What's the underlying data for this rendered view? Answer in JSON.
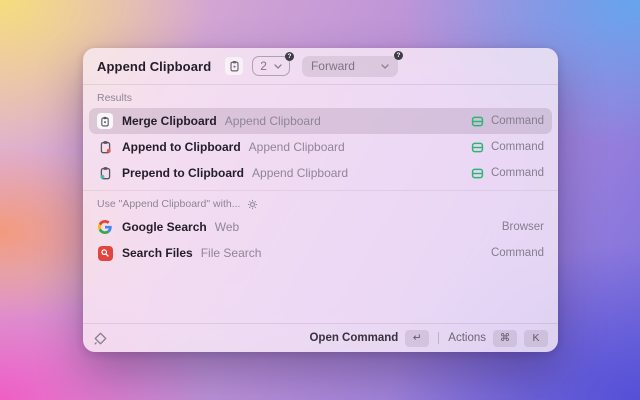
{
  "header": {
    "title": "Append Clipboard",
    "count_select": {
      "value": "2",
      "badge": "?"
    },
    "direction_select": {
      "value": "Forward",
      "badge": "?"
    }
  },
  "results": {
    "label": "Results",
    "items": [
      {
        "title": "Merge Clipboard",
        "subtitle": "Append Clipboard",
        "accessory": "Command",
        "selected": true,
        "icon": "clipboard-box-icon"
      },
      {
        "title": "Append to Clipboard",
        "subtitle": "Append Clipboard",
        "accessory": "Command",
        "selected": false,
        "icon": "clipboard-append-icon"
      },
      {
        "title": "Prepend to Clipboard",
        "subtitle": "Append Clipboard",
        "accessory": "Command",
        "selected": false,
        "icon": "clipboard-prepend-icon"
      }
    ]
  },
  "use_with": {
    "label": "Use \"Append Clipboard\" with...",
    "items": [
      {
        "title": "Google Search",
        "subtitle": "Web",
        "accessory": "Browser",
        "icon": "google-logo-icon"
      },
      {
        "title": "Search Files",
        "subtitle": "File Search",
        "accessory": "Command",
        "icon": "file-search-icon"
      }
    ]
  },
  "footer": {
    "primary_label": "Open Command",
    "primary_key": "↵",
    "actions_label": "Actions",
    "cmd_key": "⌘",
    "k_key": "K"
  },
  "colors": {
    "accessory_green": "#2bb673",
    "search_files_red": "#e0453e",
    "bg_top_left": "#f5dd7d",
    "bg_top_right": "#66a5ee",
    "bg_bottom_left": "#f05ec6",
    "bg_bottom_right": "#5450d7"
  }
}
